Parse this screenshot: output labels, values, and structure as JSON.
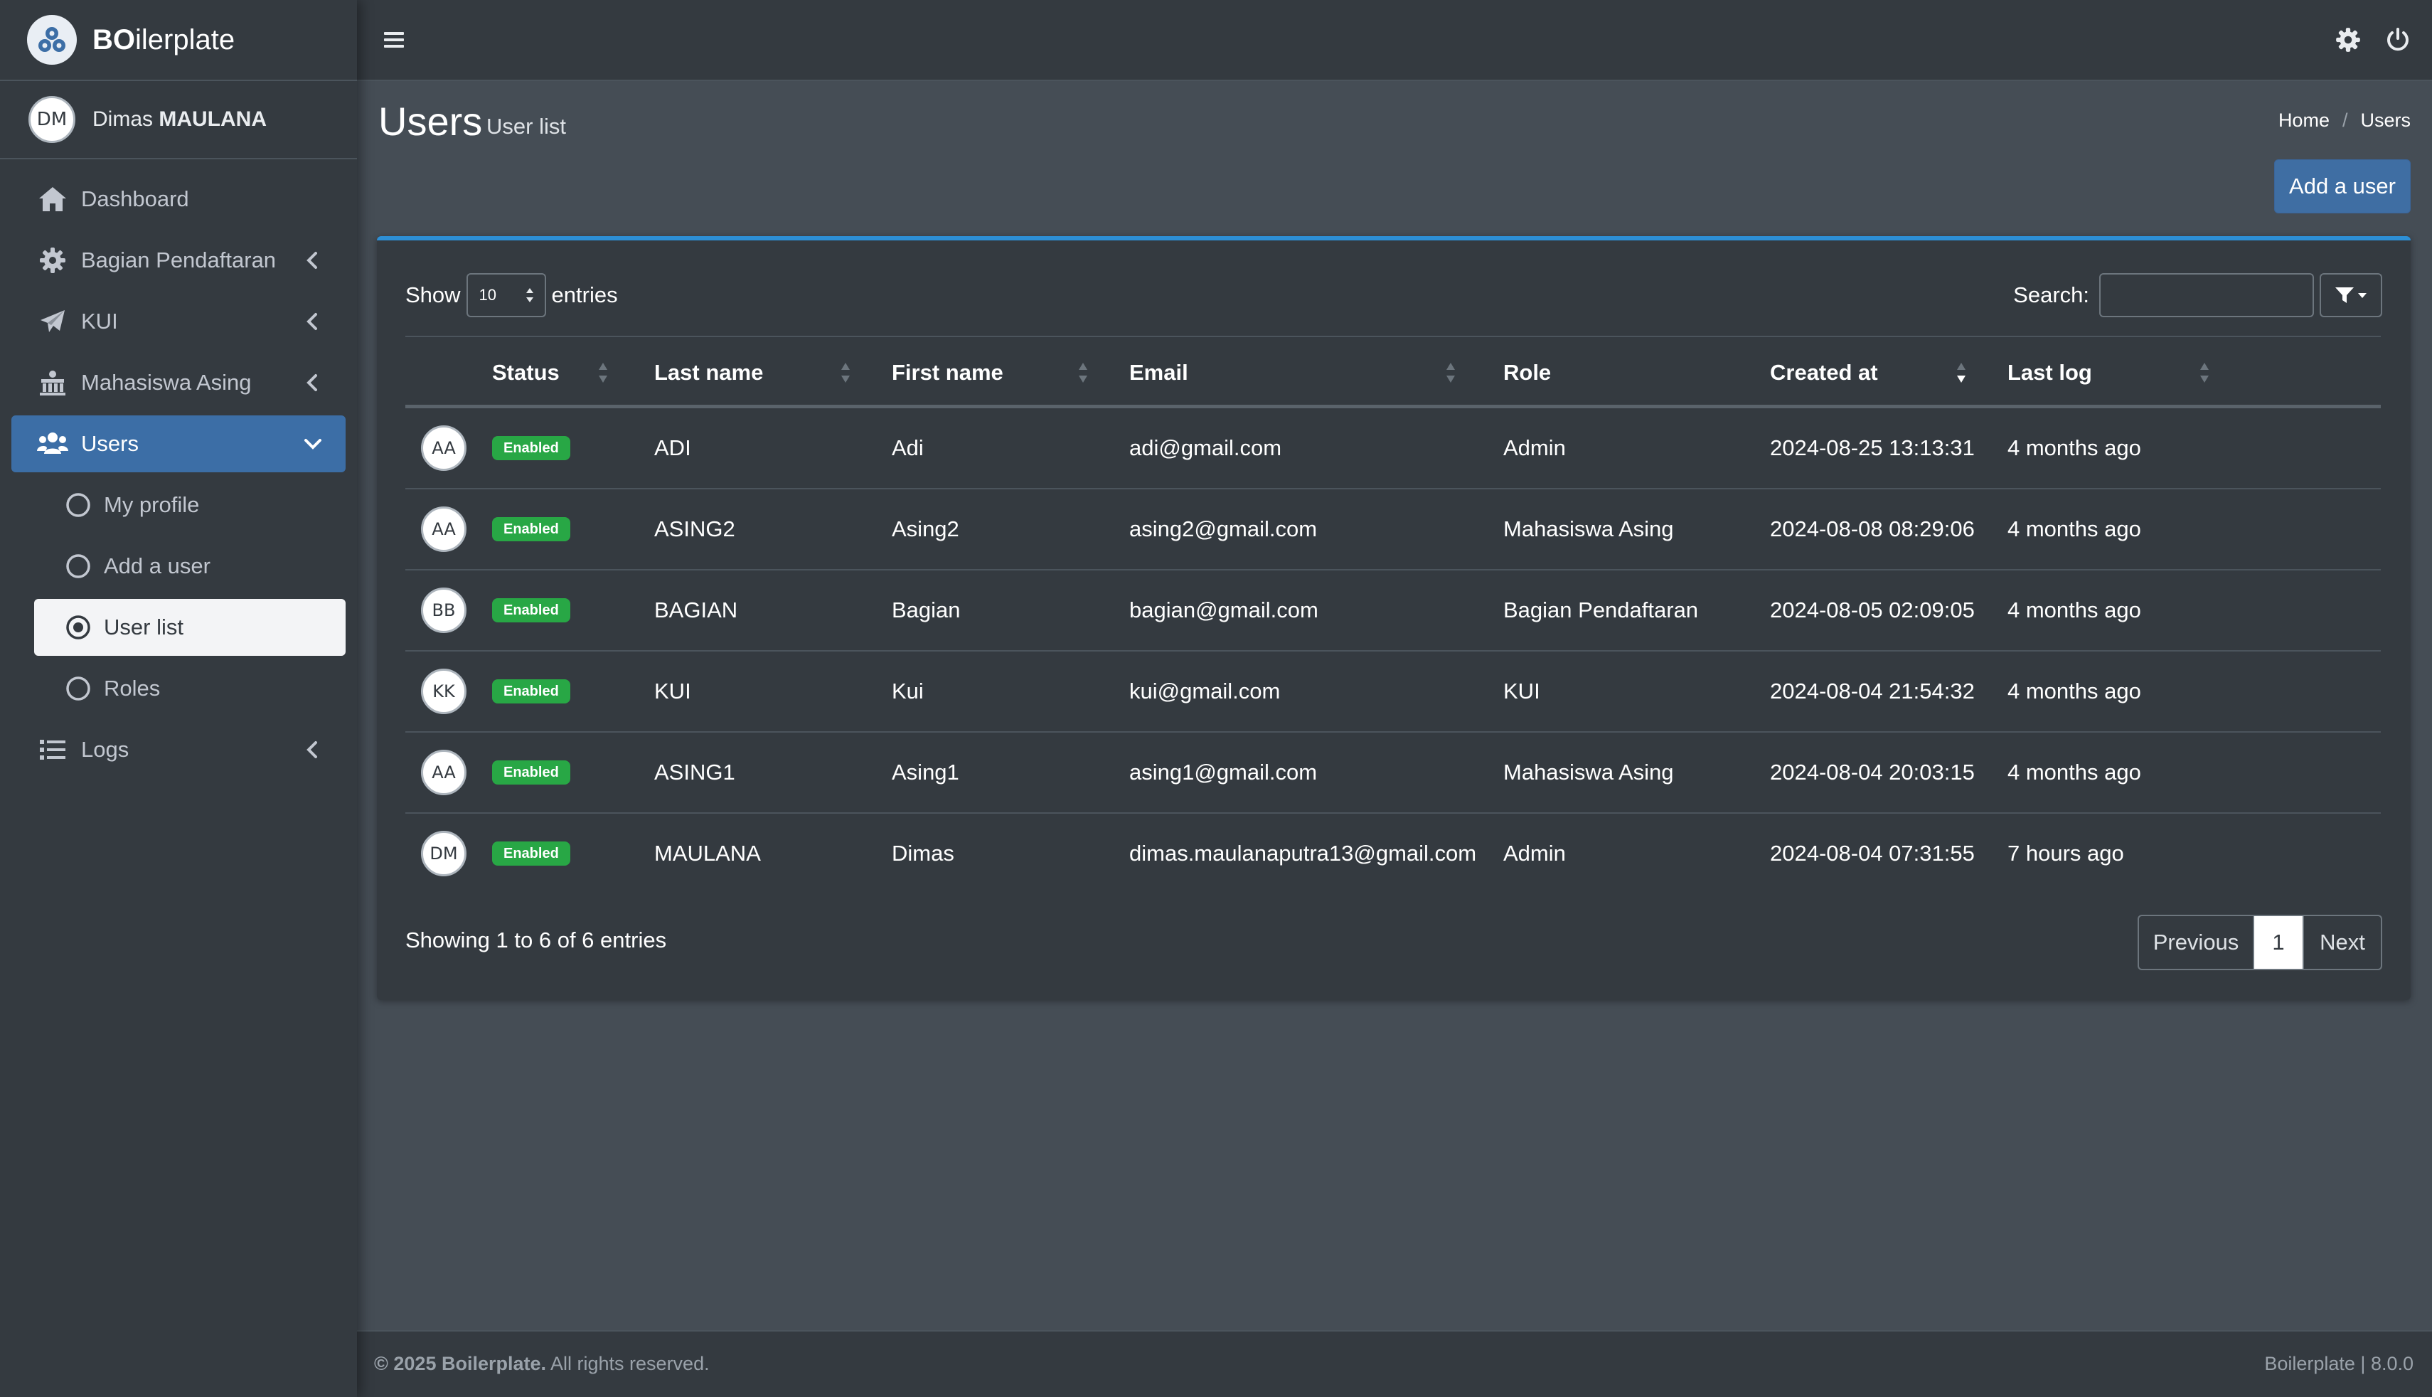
{
  "brand": {
    "name_bold": "BO",
    "name_rest": "ilerplate"
  },
  "user": {
    "initials": "DM",
    "first": "Dimas",
    "last": "MAULANA"
  },
  "sidebar": {
    "items": [
      {
        "label": "Dashboard",
        "icon": "home-icon"
      },
      {
        "label": "Bagian Pendaftaran",
        "icon": "gear-icon"
      },
      {
        "label": "KUI",
        "icon": "paper-plane-icon"
      },
      {
        "label": "Mahasiswa Asing",
        "icon": "building-icon"
      },
      {
        "label": "Users",
        "icon": "users-icon"
      },
      {
        "label": "My profile",
        "icon": "circle-icon"
      },
      {
        "label": "Add a user",
        "icon": "circle-icon"
      },
      {
        "label": "User list",
        "icon": "dot-circle-icon"
      },
      {
        "label": "Roles",
        "icon": "circle-icon"
      },
      {
        "label": "Logs",
        "icon": "list-icon"
      }
    ]
  },
  "header": {
    "title": "Users",
    "subtitle": "User list",
    "breadcrumb": [
      "Home",
      "Users"
    ],
    "add_button": "Add a user"
  },
  "table": {
    "show_label": "Show",
    "entries_label": "entries",
    "length_value": "10",
    "search_label": "Search:",
    "search_value": "",
    "columns": [
      "Status",
      "Last name",
      "First name",
      "Email",
      "Role",
      "Created at",
      "Last log"
    ],
    "rows": [
      {
        "initials": "AA",
        "status": "Enabled",
        "last": "ADI",
        "first": "Adi",
        "email": "adi@gmail.com",
        "role": "Admin",
        "created": "2024-08-25 13:13:31",
        "lastlog": "4 months ago"
      },
      {
        "initials": "AA",
        "status": "Enabled",
        "last": "ASING2",
        "first": "Asing2",
        "email": "asing2@gmail.com",
        "role": "Mahasiswa Asing",
        "created": "2024-08-08 08:29:06",
        "lastlog": "4 months ago"
      },
      {
        "initials": "BB",
        "status": "Enabled",
        "last": "BAGIAN",
        "first": "Bagian",
        "email": "bagian@gmail.com",
        "role": "Bagian Pendaftaran",
        "created": "2024-08-05 02:09:05",
        "lastlog": "4 months ago"
      },
      {
        "initials": "KK",
        "status": "Enabled",
        "last": "KUI",
        "first": "Kui",
        "email": "kui@gmail.com",
        "role": "KUI",
        "created": "2024-08-04 21:54:32",
        "lastlog": "4 months ago"
      },
      {
        "initials": "AA",
        "status": "Enabled",
        "last": "ASING1",
        "first": "Asing1",
        "email": "asing1@gmail.com",
        "role": "Mahasiswa Asing",
        "created": "2024-08-04 20:03:15",
        "lastlog": "4 months ago"
      },
      {
        "initials": "DM",
        "status": "Enabled",
        "last": "MAULANA",
        "first": "Dimas",
        "email": "dimas.maulanaputra13@gmail.com",
        "role": "Admin",
        "created": "2024-08-04 07:31:55",
        "lastlog": "7 hours ago"
      }
    ],
    "info": "Showing 1 to 6 of 6 entries",
    "pagination": {
      "previous": "Previous",
      "page": "1",
      "next": "Next"
    }
  },
  "footer": {
    "copyright_bold": "© 2025 Boilerplate.",
    "copyright_rest": " All rights reserved.",
    "version": "Boilerplate | 8.0.0"
  },
  "colors": {
    "accent": "#2d8fd5",
    "primary": "#3f6ea3",
    "success": "#28a745",
    "background": "#454d55",
    "panel": "#343a40"
  }
}
